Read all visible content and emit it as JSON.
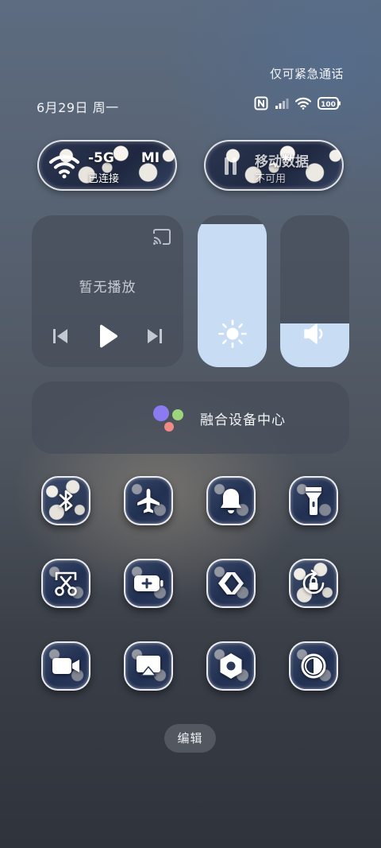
{
  "status": {
    "emergency_text": "仅可紧急通话",
    "date_text": "6月29日 周一",
    "battery_level": "100",
    "icons": [
      "nfc-icon",
      "signal-icon",
      "wifi-icon",
      "battery-icon"
    ]
  },
  "wifi_tile": {
    "title": "-5G",
    "title_suffix": "MI",
    "subtitle": "已连接",
    "icon": "wifi-icon"
  },
  "data_tile": {
    "title": "移动数据",
    "subtitle": "不可用",
    "icon": "mobile-data-icon"
  },
  "media": {
    "no_playback": "暂无播放",
    "icons": [
      "cast-icon",
      "previous-icon",
      "play-icon",
      "next-icon"
    ]
  },
  "brightness": {
    "level_percent": 94,
    "icon": "sun-icon"
  },
  "volume": {
    "level_percent": 29,
    "icon": "speaker-icon"
  },
  "device_center": {
    "label": "融合设备中心",
    "dot_colors": [
      "#8a7cf0",
      "#9ed47a",
      "#f08a84"
    ]
  },
  "toggles": [
    {
      "name": "bluetooth",
      "icon": "bluetooth-icon"
    },
    {
      "name": "airplane-mode",
      "icon": "airplane-icon"
    },
    {
      "name": "ringer",
      "icon": "bell-icon"
    },
    {
      "name": "flashlight",
      "icon": "flashlight-icon"
    },
    {
      "name": "screenshot",
      "icon": "scissors-icon"
    },
    {
      "name": "battery-saver",
      "icon": "battery-plus-icon"
    },
    {
      "name": "nearby-share",
      "icon": "share-arrows-icon"
    },
    {
      "name": "rotation-lock",
      "icon": "rotation-lock-icon"
    },
    {
      "name": "screen-record",
      "icon": "video-camera-icon"
    },
    {
      "name": "screen-cast",
      "icon": "airplay-icon"
    },
    {
      "name": "settings",
      "icon": "hex-nut-icon"
    },
    {
      "name": "dark-mode",
      "icon": "contrast-icon"
    }
  ],
  "edit_label": "编辑",
  "colors": {
    "slider_fill": "#c8dcf3",
    "card_bg": "rgba(70,78,90,0.72)"
  }
}
